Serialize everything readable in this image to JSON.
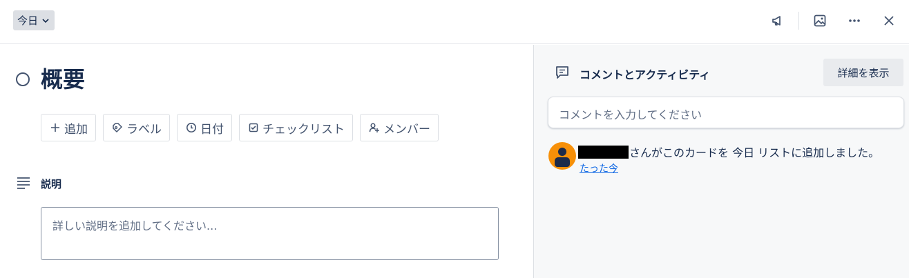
{
  "header": {
    "list_name": "今日",
    "icons": [
      "megaphone-icon",
      "image-icon",
      "more-icon",
      "close-icon"
    ]
  },
  "card": {
    "title": "概要",
    "actions": [
      {
        "label": "追加",
        "icon": "plus-icon"
      },
      {
        "label": "ラベル",
        "icon": "tag-icon"
      },
      {
        "label": "日付",
        "icon": "clock-icon"
      },
      {
        "label": "チェックリスト",
        "icon": "checkbox-icon"
      },
      {
        "label": "メンバー",
        "icon": "add-person-icon"
      }
    ],
    "description": {
      "heading": "説明",
      "placeholder": "詳しい説明を追加してください..."
    }
  },
  "activity": {
    "heading": "コメントとアクティビティ",
    "details_button": "詳細を表示",
    "comment_placeholder": "コメントを入力してください",
    "entries": [
      {
        "text": "さんがこのカードを 今日 リストに追加しました。",
        "time": "たった今"
      }
    ]
  },
  "colors": {
    "avatar": "#f79009",
    "link": "#0c66e4",
    "text": "#172b4d"
  }
}
